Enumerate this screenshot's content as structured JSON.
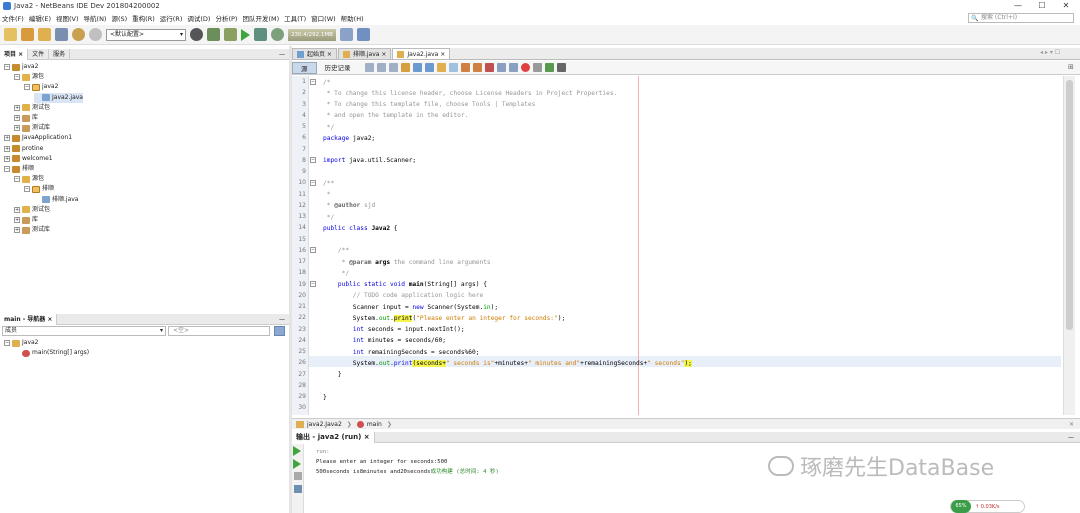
{
  "window": {
    "title": "Java2 - NetBeans IDE Dev 201804200002",
    "min": "—",
    "max": "☐",
    "close": "✕"
  },
  "menu": [
    "文件(F)",
    "编辑(E)",
    "视图(V)",
    "导航(N)",
    "源(S)",
    "重构(R)",
    "运行(R)",
    "调试(D)",
    "分析(P)",
    "团队开发(M)",
    "工具(T)",
    "窗口(W)",
    "帮助(H)"
  ],
  "search": {
    "placeholder": "搜索 (Ctrl+I)",
    "icon": "🔍"
  },
  "toolbar": {
    "config": "<默认配置>",
    "memory": "230.4/292.1MB"
  },
  "project_panel": {
    "tabs": [
      "项目 ×",
      "文件",
      "服务"
    ],
    "minimize": "—",
    "tree": [
      {
        "label": "java2",
        "depth": 0,
        "exp": "−",
        "icon": "proj"
      },
      {
        "label": "源包",
        "depth": 1,
        "exp": "−",
        "icon": "pkg"
      },
      {
        "label": "java2",
        "depth": 2,
        "exp": "−",
        "icon": "pkgi"
      },
      {
        "label": "Java2.java",
        "depth": 3,
        "exp": "",
        "icon": "file",
        "selected": true
      },
      {
        "label": "测试包",
        "depth": 1,
        "exp": "+",
        "icon": "pkg"
      },
      {
        "label": "库",
        "depth": 1,
        "exp": "+",
        "icon": "lib"
      },
      {
        "label": "测试库",
        "depth": 1,
        "exp": "+",
        "icon": "lib"
      },
      {
        "label": "JavaApplication1",
        "depth": 0,
        "exp": "+",
        "icon": "proj"
      },
      {
        "label": "protine",
        "depth": 0,
        "exp": "+",
        "icon": "proj"
      },
      {
        "label": "welcome1",
        "depth": 0,
        "exp": "+",
        "icon": "proj"
      },
      {
        "label": "排顺",
        "depth": 0,
        "exp": "−",
        "icon": "proj"
      },
      {
        "label": "源包",
        "depth": 1,
        "exp": "−",
        "icon": "pkg"
      },
      {
        "label": "排顺",
        "depth": 2,
        "exp": "−",
        "icon": "pkgi"
      },
      {
        "label": "排顺.java",
        "depth": 3,
        "exp": "",
        "icon": "file"
      },
      {
        "label": "测试包",
        "depth": 1,
        "exp": "+",
        "icon": "pkg"
      },
      {
        "label": "库",
        "depth": 1,
        "exp": "+",
        "icon": "lib"
      },
      {
        "label": "测试库",
        "depth": 1,
        "exp": "+",
        "icon": "lib"
      }
    ]
  },
  "navigator": {
    "tab": "main - 导航器 ×",
    "minimize": "—",
    "filter_label": "成员",
    "filter_placeholder": "<空>",
    "tree": [
      {
        "label": "Java2",
        "depth": 0,
        "exp": "−"
      },
      {
        "label": "main(String[] args)",
        "depth": 1,
        "exp": ""
      }
    ]
  },
  "editor": {
    "tabs": [
      {
        "label": "起始页 ×",
        "active": false
      },
      {
        "label": "排顺.java ×",
        "active": false
      },
      {
        "label": "Java2.java ×",
        "active": true
      }
    ],
    "view_tabs": [
      "源",
      "历史记录"
    ],
    "lines": [
      "1",
      "2",
      "3",
      "4",
      "5",
      "6",
      "7",
      "8",
      "9",
      "10",
      "11",
      "12",
      "13",
      "14",
      "15",
      "16",
      "17",
      "18",
      "19",
      "20",
      "21",
      "22",
      "23",
      "24",
      "25",
      "26",
      "27",
      "28",
      "29",
      "30"
    ],
    "code": [
      [
        {
          "t": "/*",
          "c": "cm"
        }
      ],
      [
        {
          "t": " * To change this license header, choose License Headers in Project Properties.",
          "c": "cm"
        }
      ],
      [
        {
          "t": " * To change this template file, choose Tools | Templates",
          "c": "cm"
        }
      ],
      [
        {
          "t": " * and open the template in the editor.",
          "c": "cm"
        }
      ],
      [
        {
          "t": " */",
          "c": "cm"
        }
      ],
      [
        {
          "t": "package",
          "c": "kw"
        },
        {
          "t": " java2;",
          "c": ""
        }
      ],
      [],
      [
        {
          "t": "import",
          "c": "kw"
        },
        {
          "t": " java.util.Scanner;",
          "c": ""
        }
      ],
      [],
      [
        {
          "t": "/**",
          "c": "cm"
        }
      ],
      [
        {
          "t": " *",
          "c": "cm"
        }
      ],
      [
        {
          "t": " * ",
          "c": "cm"
        },
        {
          "t": "@author",
          "c": "tag"
        },
        {
          "t": " sjd",
          "c": "cm"
        }
      ],
      [
        {
          "t": " */",
          "c": "cm"
        }
      ],
      [
        {
          "t": "public class",
          "c": "kw"
        },
        {
          "t": " ",
          "c": ""
        },
        {
          "t": "Java2",
          "c": "mth"
        },
        {
          "t": " {",
          "c": ""
        }
      ],
      [],
      [
        {
          "t": "    /**",
          "c": "cm"
        }
      ],
      [
        {
          "t": "     * ",
          "c": "cm"
        },
        {
          "t": "@param",
          "c": "tag"
        },
        {
          "t": " args",
          "c": "mth"
        },
        {
          "t": " the command line arguments",
          "c": "cm"
        }
      ],
      [
        {
          "t": "     */",
          "c": "cm"
        }
      ],
      [
        {
          "t": "    public static void",
          "c": "kw"
        },
        {
          "t": " ",
          "c": ""
        },
        {
          "t": "main",
          "c": "mth"
        },
        {
          "t": "(String[] args) {",
          "c": ""
        }
      ],
      [
        {
          "t": "        // TODO code application logic here",
          "c": "cm"
        }
      ],
      [
        {
          "t": "        Scanner input = ",
          "c": ""
        },
        {
          "t": "new",
          "c": "kw"
        },
        {
          "t": " Scanner(System.",
          "c": ""
        },
        {
          "t": "in",
          "c": "fld"
        },
        {
          "t": ");",
          "c": ""
        }
      ],
      [
        {
          "t": "        System.",
          "c": ""
        },
        {
          "t": "out",
          "c": "fld"
        },
        {
          "t": ".",
          "c": ""
        },
        {
          "t": "print",
          "c": "hl"
        },
        {
          "t": "(",
          "c": ""
        },
        {
          "t": "\"Please enter an integer for seconds:\"",
          "c": "str"
        },
        {
          "t": ");",
          "c": ""
        }
      ],
      [
        {
          "t": "        ",
          "c": ""
        },
        {
          "t": "int",
          "c": "kw"
        },
        {
          "t": " seconds = input.nextInt();",
          "c": ""
        }
      ],
      [
        {
          "t": "        ",
          "c": ""
        },
        {
          "t": "int",
          "c": "kw"
        },
        {
          "t": " minutes = seconds/60;",
          "c": ""
        }
      ],
      [
        {
          "t": "        ",
          "c": ""
        },
        {
          "t": "int",
          "c": "kw"
        },
        {
          "t": " remainingSeconds = seconds%60;",
          "c": ""
        }
      ],
      [
        {
          "t": "        System.",
          "c": ""
        },
        {
          "t": "out",
          "c": "fld"
        },
        {
          "t": ".",
          "c": ""
        },
        {
          "t": "print",
          "c": "kw"
        },
        {
          "t": "(seconds+",
          "c": "hl"
        },
        {
          "t": "\" seconds is\"",
          "c": "str"
        },
        {
          "t": "+minutes+",
          "c": ""
        },
        {
          "t": "\" minutes and\"",
          "c": "str"
        },
        {
          "t": "+remainingSeconds+",
          "c": ""
        },
        {
          "t": "\" seconds\"",
          "c": "str"
        },
        {
          "t": ");",
          "c": "hl"
        }
      ],
      [
        {
          "t": "    }",
          "c": ""
        }
      ],
      [],
      [
        {
          "t": "}",
          "c": ""
        }
      ],
      []
    ],
    "breadcrumb": [
      "java2.Java2",
      "main"
    ]
  },
  "output": {
    "tab": "输出 - java2 (run) ×",
    "lines": [
      {
        "t": "run:",
        "c": "cm"
      },
      {
        "t": "Please enter an integer for seconds:500",
        "c": ""
      },
      {
        "t": "500seconds is8minutes and20seconds成功构建 (总时间: 4 秒)",
        "c": "ok"
      }
    ]
  },
  "watermark": {
    "text": "琢磨先生DataBase"
  },
  "netspeed": {
    "percent": "65%",
    "rate": "↑ 0.03K/s"
  }
}
